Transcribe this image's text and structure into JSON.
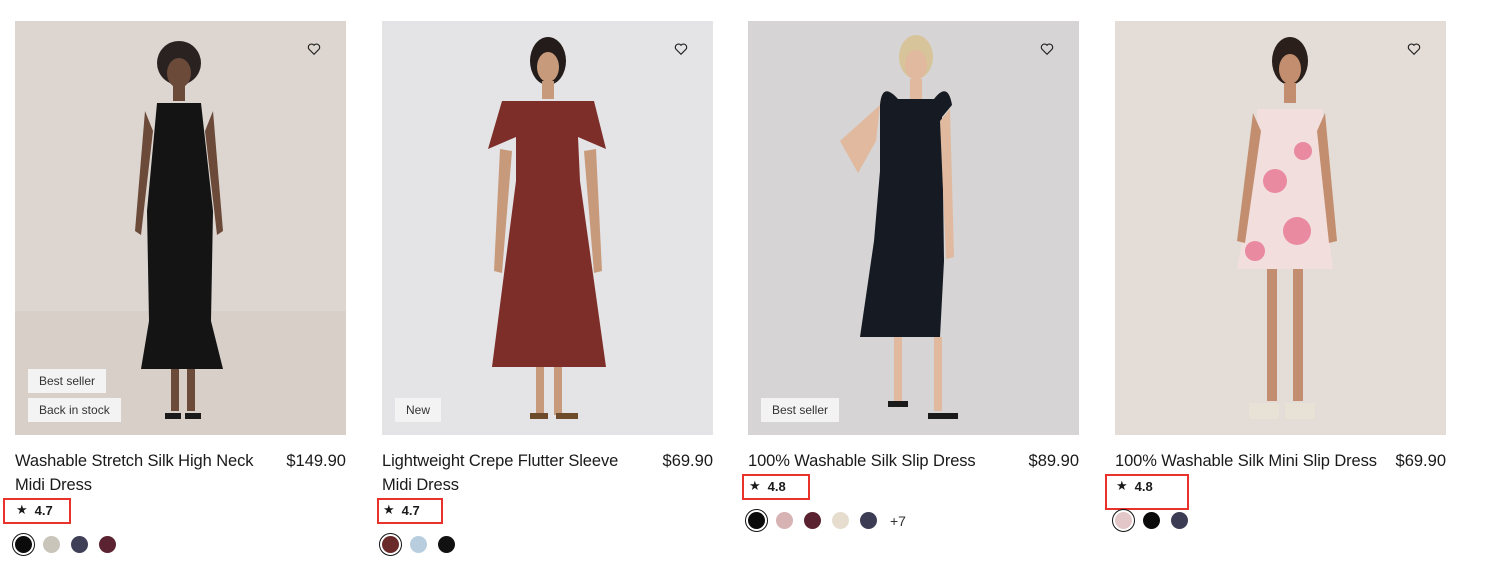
{
  "products": [
    {
      "name": "Washable Stretch Silk High Neck Midi Dress",
      "price": "$149.90",
      "rating": "4.7",
      "badges": [
        "Best seller",
        "Back in stock"
      ],
      "photo_bg": "#ddd6d0",
      "dress_color": "#141414",
      "swatch_colors": [
        "#0b0b0b",
        "#c9c5bb",
        "#3f4058",
        "#5b2331"
      ],
      "more_colors": ""
    },
    {
      "name": "Lightweight Crepe Flutter Sleeve Midi Dress",
      "price": "$69.90",
      "rating": "4.7",
      "badges": [
        "New"
      ],
      "photo_bg": "#e4e3e6",
      "dress_color": "#7e2e29",
      "swatch_colors": [
        "#6b2a2a",
        "#b8cede",
        "#111111"
      ],
      "more_colors": ""
    },
    {
      "name": "100% Washable Silk Slip Dress",
      "price": "$89.90",
      "rating": "4.8",
      "badges": [
        "Best seller"
      ],
      "photo_bg": "#d6d4d5",
      "dress_color": "#161a22",
      "swatch_colors": [
        "#0b0b0b",
        "#d8b3b3",
        "#5a2230",
        "#e6ddcf",
        "#3c3d55"
      ],
      "more_colors": "+7"
    },
    {
      "name": "100% Washable Silk Mini Slip Dress",
      "price": "$69.90",
      "rating": "4.8",
      "badges": [],
      "photo_bg": "#e3dcd7",
      "dress_color": "#f2dedd",
      "swatch_colors": [
        "#e2c6c8",
        "#0b0b0b",
        "#3c3d55"
      ],
      "more_colors": ""
    }
  ],
  "accent_highlight": "#e8322b"
}
